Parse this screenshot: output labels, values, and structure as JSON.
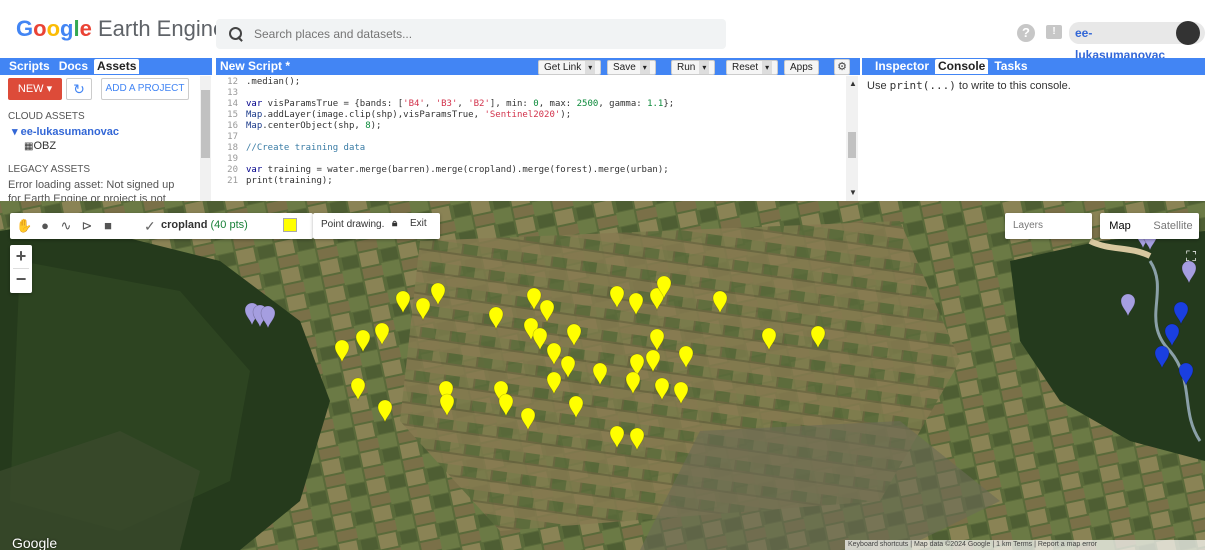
{
  "header": {
    "logo_google": "Google",
    "logo_product": "Earth Engine",
    "search_placeholder": "Search places and datasets...",
    "help_icon": "?",
    "user": "ee-lukasumanovac"
  },
  "left_panel": {
    "tabs": [
      "Scripts",
      "Docs",
      "Assets"
    ],
    "new_label": "NEW ▾",
    "add_project_label": "ADD A PROJECT",
    "cloud_assets_heading": "CLOUD ASSETS",
    "project_name": "ee-lukasumanovac",
    "table_asset": "OBZ",
    "legacy_heading": "LEGACY ASSETS",
    "legacy_error_1": "Error loading asset: Not signed up",
    "legacy_error_2": "for Earth Engine or project is not"
  },
  "editor": {
    "title": "New Script *",
    "buttons": {
      "get_link": "Get Link",
      "save": "Save",
      "run": "Run",
      "reset": "Reset",
      "apps": "Apps"
    },
    "lines": [
      {
        "n": "12",
        "text": ".median();"
      },
      {
        "n": "13",
        "text": ""
      },
      {
        "n": "14",
        "text": "var visParamsTrue = {bands: ['B4', 'B3', 'B2'], min: 0, max: 2500, gamma: 1.1};"
      },
      {
        "n": "15",
        "text": "Map.addLayer(image.clip(shp),visParamsTrue, 'Sentinel2020');"
      },
      {
        "n": "16",
        "text": "Map.centerObject(shp, 8);"
      },
      {
        "n": "17",
        "text": ""
      },
      {
        "n": "18",
        "text": "//Create training data"
      },
      {
        "n": "19",
        "text": ""
      },
      {
        "n": "20",
        "text": "var training = water.merge(barren).merge(cropland).merge(forest).merge(urban);"
      },
      {
        "n": "21",
        "text": "print(training);"
      }
    ]
  },
  "right_panel": {
    "tabs": [
      "Inspector",
      "Console",
      "Tasks"
    ],
    "console_prefix": "Use ",
    "console_code": "print(...)",
    "console_suffix": " to write to this console."
  },
  "map": {
    "layer_name": "cropland",
    "layer_count": "(40 pts)",
    "layer_color": "#ffff00",
    "point_drawing_label": "Point drawing.",
    "exit_label": "Exit",
    "layers_label": "Layers",
    "map_label": "Map",
    "satellite_label": "Satellite",
    "zoom_in": "+",
    "zoom_out": "−",
    "google_watermark": "Google",
    "attribution": "Keyboard shortcuts  |  Map data ©2024 Google  |  1 km         Terms  |  Report a map error",
    "colors": {
      "cropland": "#ffff00",
      "barren": "#a59ee0",
      "water": "#1a3fe0"
    }
  }
}
